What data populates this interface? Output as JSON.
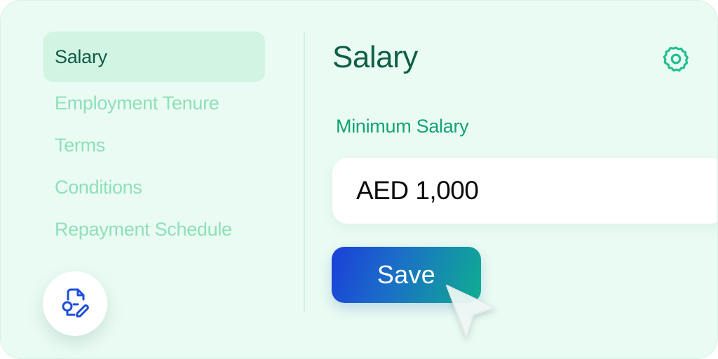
{
  "sidebar": {
    "items": [
      {
        "label": "Salary",
        "active": true
      },
      {
        "label": "Employment Tenure",
        "active": false
      },
      {
        "label": "Terms",
        "active": false
      },
      {
        "label": "Conditions",
        "active": false
      },
      {
        "label": "Repayment Schedule",
        "active": false
      }
    ],
    "fab_icon": "document-edit-icon"
  },
  "main": {
    "title": "Salary",
    "settings_icon": "gear-icon",
    "field": {
      "label": "Minimum Salary",
      "value": "AED 1,000"
    },
    "save_label": "Save"
  },
  "colors": {
    "background": "#eafbf3",
    "active_item_bg": "#d2f5e3",
    "title": "#0f5e47",
    "inactive_item": "#8ee0b9",
    "field_label": "#12a374",
    "button_gradient_start": "#1b3fd9",
    "button_gradient_end": "#0fae91",
    "icon_blue": "#1d4ed8"
  },
  "cursor_icon": "pointer-cursor-icon"
}
